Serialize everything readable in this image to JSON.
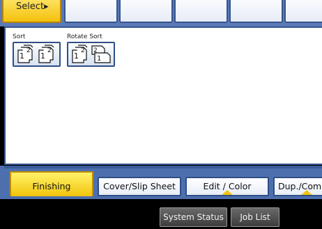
{
  "top": {
    "select_label": "Select▸"
  },
  "finishing": {
    "groups": [
      {
        "label": "Sort",
        "icons": [
          "sort-icon",
          "sort-icon"
        ]
      },
      {
        "label": "Rotate Sort",
        "icons": [
          "sort-icon",
          "rotate-sort-icon"
        ]
      }
    ]
  },
  "tabs": [
    {
      "label": "Finishing",
      "active": true
    },
    {
      "label": "Cover/Slip Sheet",
      "active": false
    },
    {
      "label": "Edit / Color",
      "active": false
    },
    {
      "label": "Dup./Combine",
      "active": false
    }
  ],
  "bottom": {
    "system_status": "System Status",
    "job_list": "Job List"
  },
  "colors": {
    "active_tab": "#f2c40c",
    "frame_blue": "#4e6fae",
    "border_blue": "#2e4e86"
  }
}
